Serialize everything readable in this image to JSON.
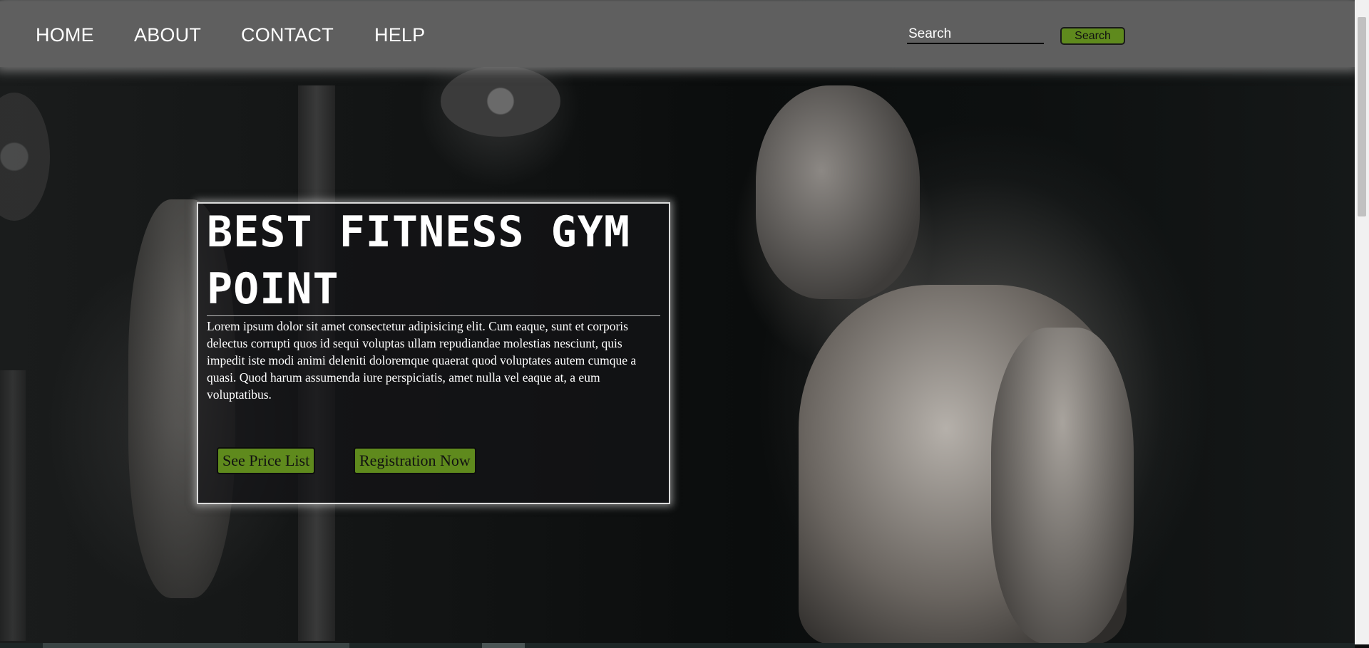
{
  "nav": {
    "links": [
      "HOME",
      "ABOUT",
      "CONTACT",
      "HELP"
    ]
  },
  "search": {
    "placeholder": "Search",
    "button_label": "Search"
  },
  "hero": {
    "title": "BEST FITNESS GYM POINT",
    "text": "Lorem ipsum dolor sit amet consectetur adipisicing elit. Cum eaque, sunt et corporis delectus corrupti quos id sequi voluptas ullam repudiandae molestias nesciunt, quis impedit iste modi animi deleniti doloremque quaerat quod voluptates autem cumque a quasi. Quod harum assumenda iure perspiciatis, amet nulla vel eaque at, a eum voluptatibus.",
    "buttons": {
      "price_list": "See Price List",
      "register": "Registration Now"
    }
  },
  "colors": {
    "accent_green": "#5f8a1d",
    "navbar_gray": "#5f5f5f"
  }
}
